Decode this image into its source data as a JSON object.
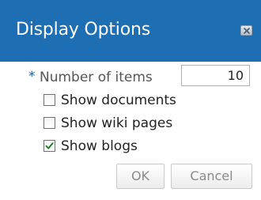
{
  "dialog": {
    "title": "Display Options",
    "close_icon": "close-icon",
    "colors": {
      "titlebar": "#1e6eb3",
      "title_text": "#ffffff",
      "required_star": "#1f5ea8",
      "checkmark": "#1a7a2a"
    }
  },
  "form": {
    "required_marker": "*",
    "number_of_items": {
      "label": "Number of items",
      "value": "10"
    },
    "options": [
      {
        "label": "Show documents",
        "checked": false
      },
      {
        "label": "Show wiki pages",
        "checked": false
      },
      {
        "label": "Show blogs",
        "checked": true
      }
    ]
  },
  "buttons": {
    "ok_label": "OK",
    "cancel_label": "Cancel"
  }
}
